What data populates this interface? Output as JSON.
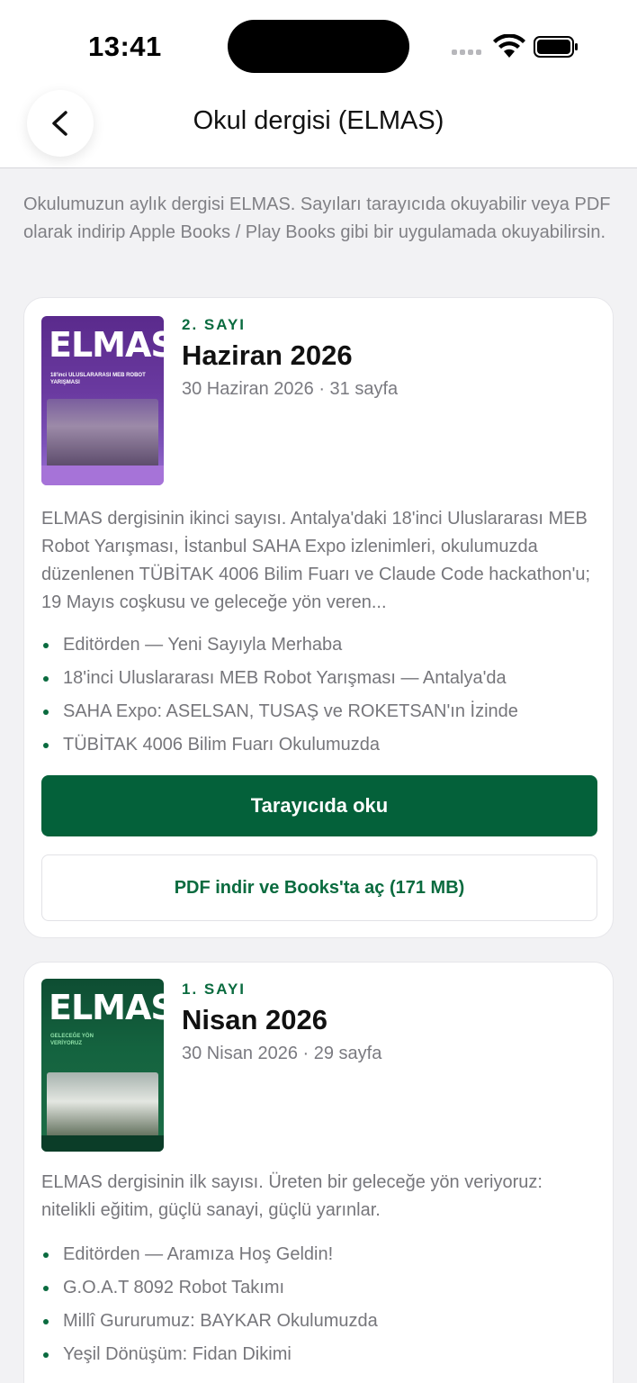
{
  "status_bar": {
    "time": "13:41"
  },
  "header": {
    "title": "Okul dergisi (ELMAS)"
  },
  "intro": "Okulumuzun aylık dergisi ELMAS. Sayıları tarayıcıda okuyabilir veya PDF olarak indirip Apple Books / Play Books gibi bir uygulamada okuyabilirsin.",
  "issues": [
    {
      "cover_logo": "ELMAS",
      "cover_headline": "18'inci ULUSLARARASI MEB ROBOT YARIŞMASI",
      "issue_no": "2. SAYI",
      "title": "Haziran 2026",
      "meta": "30 Haziran 2026 · 31 sayfa",
      "description": "ELMAS dergisinin ikinci sayısı. Antalya'daki 18'inci Uluslararası MEB Robot Yarışması, İstanbul SAHA Expo izlenimleri, okulumuzda düzenlenen TÜBİTAK 4006 Bilim Fuarı ve Claude Code hackathon'u; 19 Mayıs coşkusu ve geleceğe yön veren...",
      "articles": [
        "Editörden — Yeni Sayıyla Merhaba",
        "18'inci Uluslararası MEB Robot Yarışması — Antalya'da",
        "SAHA Expo: ASELSAN, TUSAŞ ve ROKETSAN'ın İzinde",
        "TÜBİTAK 4006 Bilim Fuarı Okulumuzda"
      ],
      "read_label": "Tarayıcıda oku",
      "pdf_label": "PDF indir ve Books'ta aç (171 MB)"
    },
    {
      "cover_logo": "ELMAS",
      "cover_headline": "GELECEĞE YÖN VERİYORUZ",
      "issue_no": "1. SAYI",
      "title": "Nisan 2026",
      "meta": "30 Nisan 2026 · 29 sayfa",
      "description": "ELMAS dergisinin ilk sayısı. Üreten bir geleceğe yön veriyoruz: nitelikli eğitim, güçlü sanayi, güçlü yarınlar.",
      "articles": [
        "Editörden — Aramıza Hoş Geldin!",
        "G.O.A.T 8092 Robot Takımı",
        "Millî Gururumuz: BAYKAR Okulumuzda",
        "Yeşil Dönüşüm: Fidan Dikimi"
      ]
    }
  ]
}
